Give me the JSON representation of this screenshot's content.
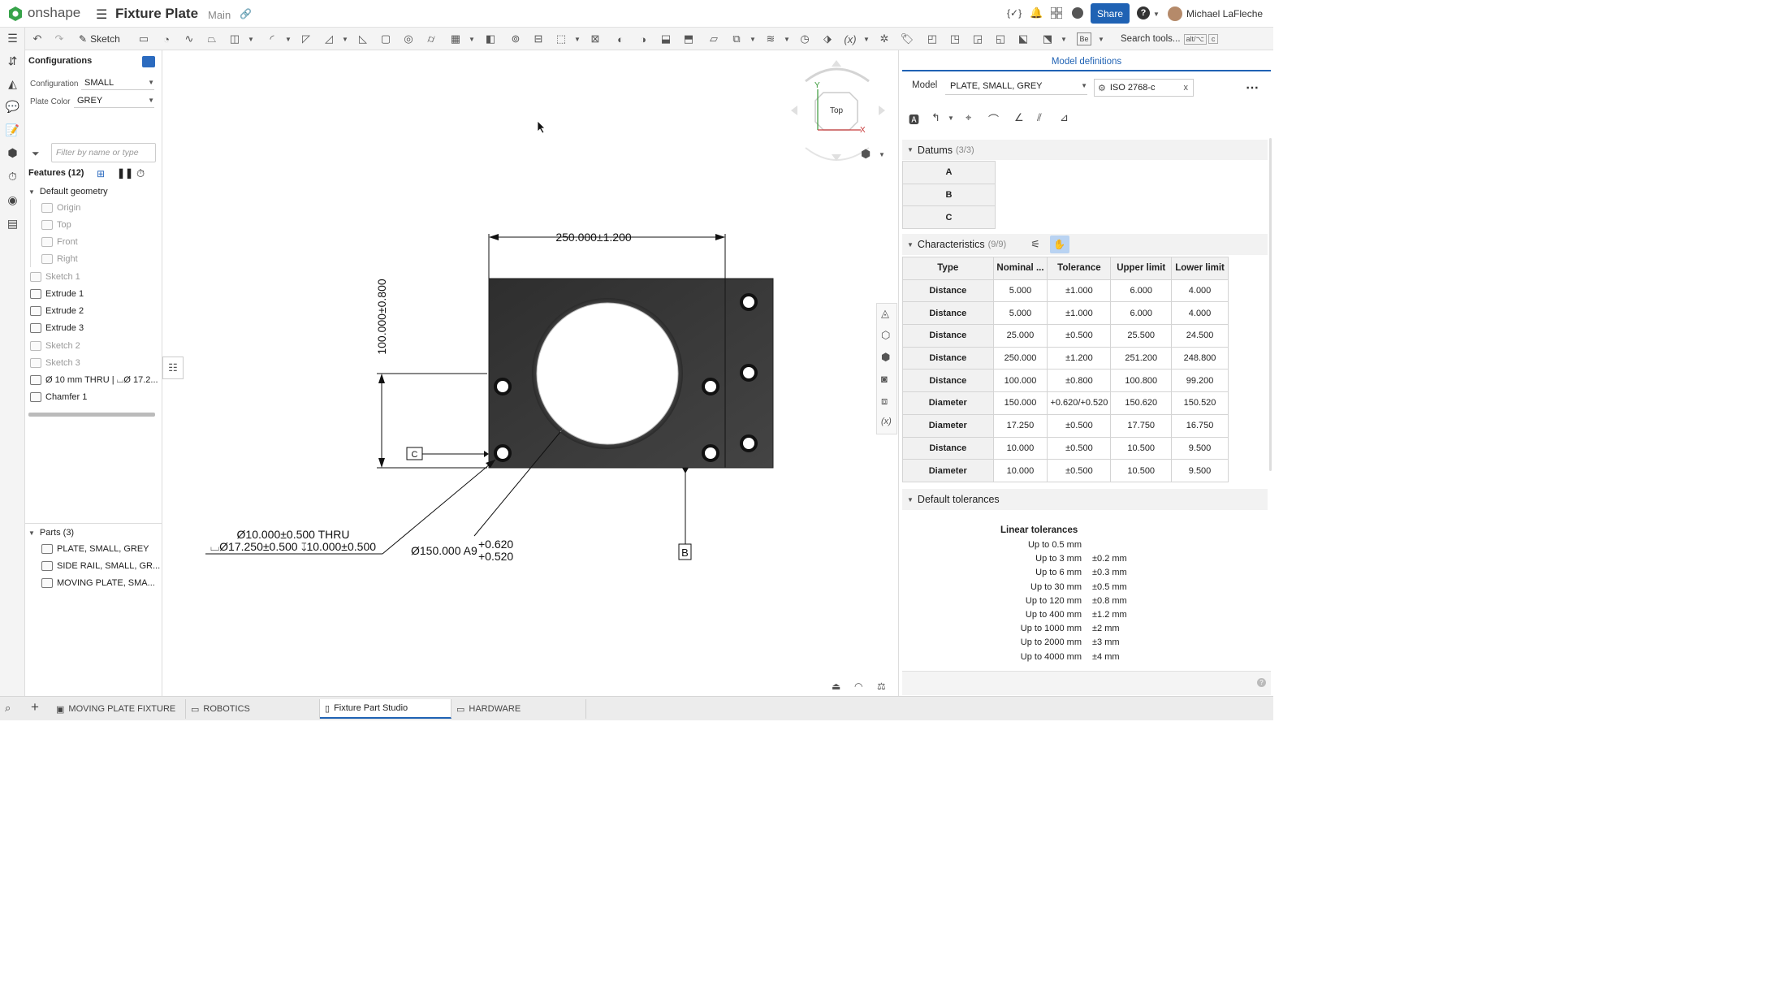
{
  "app": {
    "brand": "onshape",
    "doc_title": "Fixture Plate",
    "branch": "Main",
    "share_label": "Share",
    "user_name": "Michael LaFleche"
  },
  "toolbar": {
    "sketch_label": "Sketch",
    "search_placeholder": "Search tools...",
    "search_shortcut_1": "alt/⌥",
    "search_shortcut_2": "c",
    "be_label": "Be"
  },
  "configurations": {
    "title": "Configurations",
    "rows": [
      {
        "label": "Configuration",
        "value": "SMALL"
      },
      {
        "label": "Plate Color",
        "value": "GREY"
      }
    ]
  },
  "filter": {
    "placeholder": "Filter by name or type"
  },
  "features": {
    "header": "Features (12)",
    "group": "Default geometry",
    "items": [
      {
        "label": "Origin",
        "dim": true
      },
      {
        "label": "Top",
        "dim": true
      },
      {
        "label": "Front",
        "dim": true
      },
      {
        "label": "Right",
        "dim": true
      },
      {
        "label": "Sketch 1",
        "dim": true
      },
      {
        "label": "Extrude 1",
        "dim": false
      },
      {
        "label": "Extrude 2",
        "dim": false
      },
      {
        "label": "Extrude 3",
        "dim": false
      },
      {
        "label": "Sketch 2",
        "dim": true
      },
      {
        "label": "Sketch 3",
        "dim": true
      },
      {
        "label": "Ø 10 mm THRU | ⌴Ø 17.2...",
        "dim": false
      },
      {
        "label": "Chamfer 1",
        "dim": false
      }
    ]
  },
  "parts": {
    "header": "Parts (3)",
    "items": [
      "PLATE, SMALL, GREY",
      "SIDE RAIL, SMALL, GR...",
      "MOVING PLATE, SMA..."
    ]
  },
  "viewcube": {
    "face": "Top",
    "axis_y": "Y",
    "axis_x": "X"
  },
  "drawing": {
    "dim_width": "250.000±1.200",
    "dim_height": "100.000±0.800",
    "datum_c": "C",
    "datum_b": "B",
    "hole_line1": "Ø10.000±0.500 THRU",
    "hole_line2": "⌴Ø17.250±0.500 ↧10.000±0.500",
    "bore_main": "Ø150.000 A9",
    "bore_upper": "+0.620",
    "bore_lower": "+0.520"
  },
  "model_def": {
    "title": "Model definitions",
    "model_label": "Model",
    "model_value": "PLATE, SMALL, GREY",
    "standard": "ISO 2768-c",
    "standard_clear": "x",
    "datums_title": "Datums",
    "datums_count": "(3/3)",
    "datums": [
      "A",
      "B",
      "C"
    ],
    "chars_title": "Characteristics",
    "chars_count": "(9/9)",
    "columns": [
      "Type",
      "Nominal ...",
      "Tolerance",
      "Upper limit",
      "Lower limit"
    ],
    "rows": [
      [
        "Distance",
        "5.000",
        "±1.000",
        "6.000",
        "4.000"
      ],
      [
        "Distance",
        "5.000",
        "±1.000",
        "6.000",
        "4.000"
      ],
      [
        "Distance",
        "25.000",
        "±0.500",
        "25.500",
        "24.500"
      ],
      [
        "Distance",
        "250.000",
        "±1.200",
        "251.200",
        "248.800"
      ],
      [
        "Distance",
        "100.000",
        "±0.800",
        "100.800",
        "99.200"
      ],
      [
        "Diameter",
        "150.000",
        "+0.620/+0.520",
        "150.620",
        "150.520"
      ],
      [
        "Diameter",
        "17.250",
        "±0.500",
        "17.750",
        "16.750"
      ],
      [
        "Distance",
        "10.000",
        "±0.500",
        "10.500",
        "9.500"
      ],
      [
        "Diameter",
        "10.000",
        "±0.500",
        "10.500",
        "9.500"
      ]
    ],
    "default_tol_title": "Default tolerances",
    "linear_title": "Linear tolerances",
    "linear": [
      [
        "Up to 0.5 mm",
        ""
      ],
      [
        "Up to 3 mm",
        "±0.2 mm"
      ],
      [
        "Up to 6 mm",
        "±0.3 mm"
      ],
      [
        "Up to 30 mm",
        "±0.5 mm"
      ],
      [
        "Up to 120 mm",
        "±0.8 mm"
      ],
      [
        "Up to 400 mm",
        "±1.2 mm"
      ],
      [
        "Up to 1000 mm",
        "±2 mm"
      ],
      [
        "Up to 2000 mm",
        "±3 mm"
      ],
      [
        "Up to 4000 mm",
        "±4 mm"
      ]
    ]
  },
  "tabs": [
    "MOVING PLATE FIXTURE",
    "ROBOTICS",
    "Fixture Part Studio",
    "HARDWARE"
  ],
  "colors": {
    "accent": "#1f62b4",
    "brand_green": "#37a34a",
    "plate": "#3a3a3a"
  }
}
